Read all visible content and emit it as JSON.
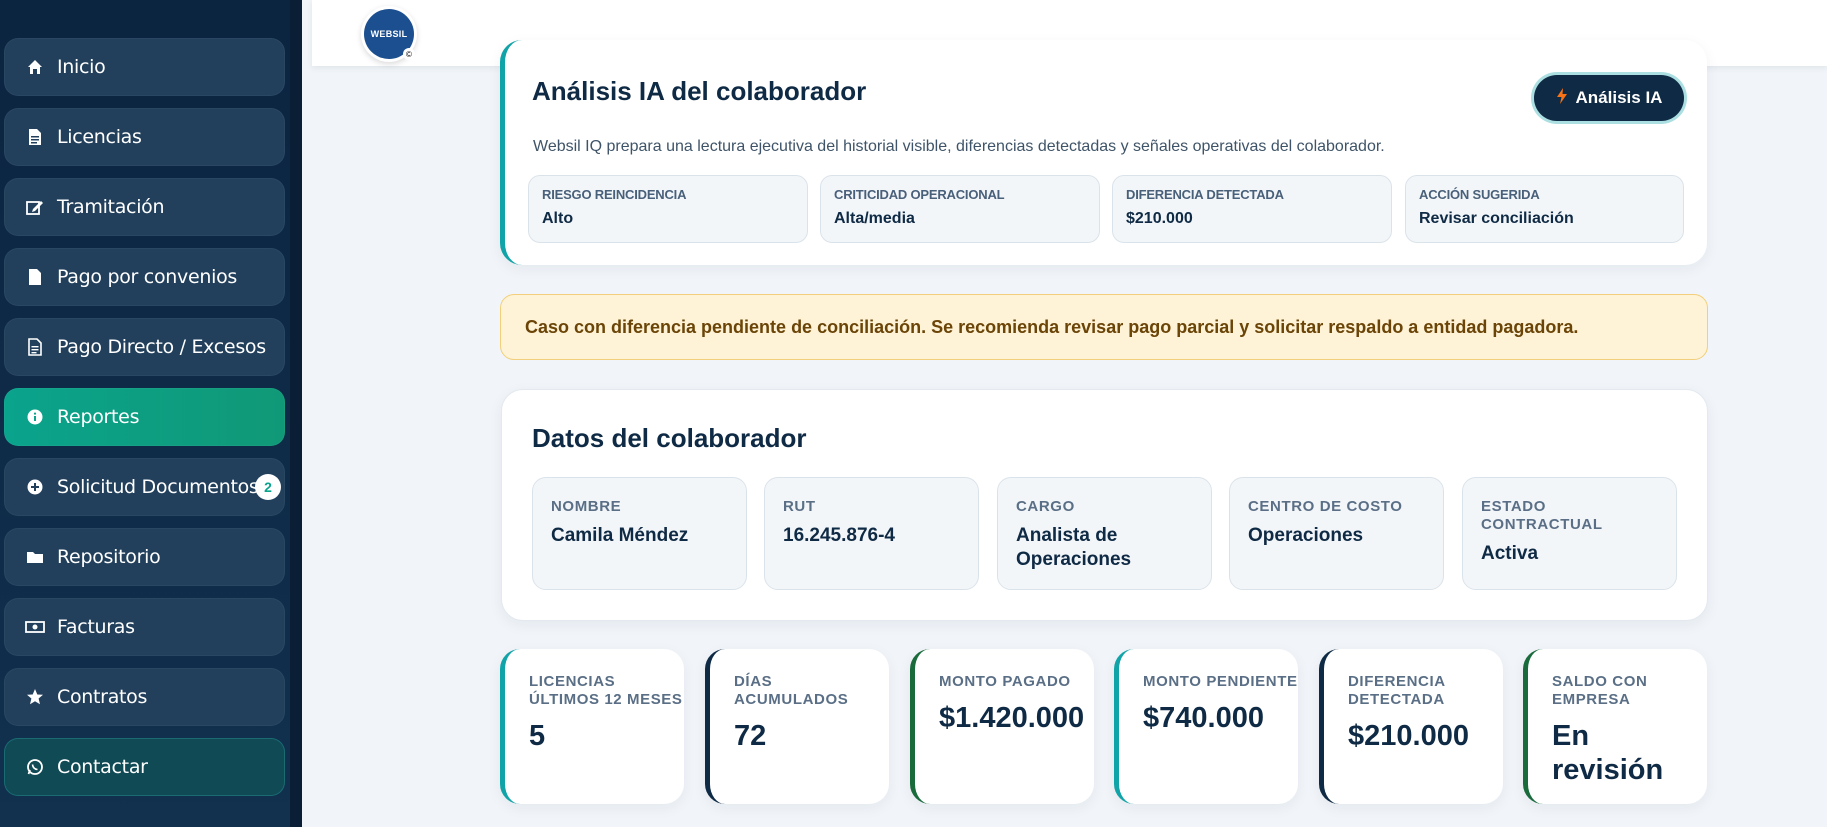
{
  "sidebar": {
    "items": [
      {
        "label": "Inicio",
        "icon": "home-icon"
      },
      {
        "label": "Licencias",
        "icon": "document-icon"
      },
      {
        "label": "Tramitación",
        "icon": "edit-icon"
      },
      {
        "label": "Pago por convenios",
        "icon": "file-icon"
      },
      {
        "label": "Pago Directo / Excesos",
        "icon": "file-text-icon"
      },
      {
        "label": "Reportes",
        "icon": "info-icon",
        "active": true
      },
      {
        "label": "Solicitud Documentos",
        "icon": "plus-circle-icon",
        "badge": "2"
      },
      {
        "label": "Repositorio",
        "icon": "folder-icon"
      },
      {
        "label": "Facturas",
        "icon": "money-icon"
      },
      {
        "label": "Contratos",
        "icon": "star-icon"
      },
      {
        "label": "Contactar",
        "icon": "whatsapp-icon"
      }
    ]
  },
  "header": {
    "logo_text": "WEBSIL",
    "logo_badge": "©"
  },
  "ai": {
    "title": "Análisis IA del colaborador",
    "button_label": "Análisis IA",
    "description": "Websil IQ prepara una lectura ejecutiva del historial visible, diferencias detectadas y señales operativas del colaborador.",
    "metrics": [
      {
        "label": "Riesgo reincidencia",
        "value": "Alto"
      },
      {
        "label": "Criticidad operacional",
        "value": "Alta/media"
      },
      {
        "label": "Diferencia detectada",
        "value": "$210.000"
      },
      {
        "label": "Acción sugerida",
        "value": "Revisar conciliación"
      }
    ]
  },
  "alert": {
    "text": "Caso con diferencia pendiente de conciliación. Se recomienda revisar pago parcial y solicitar respaldo a entidad pagadora."
  },
  "datos": {
    "title": "Datos del colaborador",
    "fields": [
      {
        "label": "Nombre",
        "value": "Camila Méndez"
      },
      {
        "label": "RUT",
        "value": "16.245.876-4"
      },
      {
        "label": "Cargo",
        "value": "Analista de Operaciones"
      },
      {
        "label": "Centro de costo",
        "value": "Operaciones"
      },
      {
        "label": "Estado contractual",
        "value": "Activa"
      }
    ]
  },
  "stats": [
    {
      "label": "Licencias últimos 12 meses",
      "value": "5",
      "accent": "#10a3a8"
    },
    {
      "label": "Días acumulados",
      "value": "72",
      "accent": "#0f2a44"
    },
    {
      "label": "Monto pagado",
      "value": "$1.420.000",
      "accent": "#1a6b3c"
    },
    {
      "label": "Monto pendiente",
      "value": "$740.000",
      "accent": "#10a3a8"
    },
    {
      "label": "Diferencia detectada",
      "value": "$210.000",
      "accent": "#0f2a44"
    },
    {
      "label": "Saldo con empresa",
      "value": "En revisión",
      "accent": "#1a6b3c"
    }
  ]
}
